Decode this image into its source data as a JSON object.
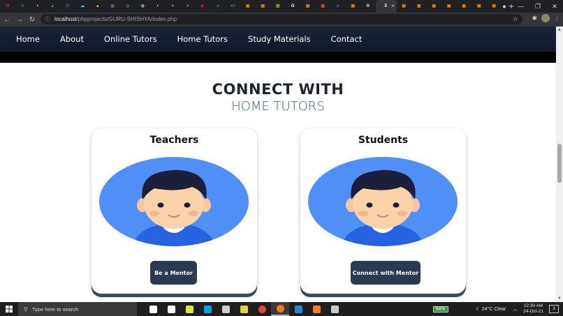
{
  "browser": {
    "tab_favicons": [
      {
        "icon": "gmail-icon",
        "color": "#c5221f",
        "glyph": "M"
      },
      {
        "icon": "docs-icon",
        "color": "#4285f4",
        "glyph": "≡"
      },
      {
        "icon": "app-icon",
        "color": "#e0e0e0",
        "glyph": "•"
      },
      {
        "icon": "drive-icon",
        "color": "#1fa463",
        "glyph": "▲"
      },
      {
        "icon": "d-icon",
        "color": "#1967d2",
        "glyph": "D"
      },
      {
        "icon": "cloud-icon",
        "color": "#4fc3f7",
        "glyph": "☁"
      },
      {
        "icon": "drive-icon",
        "color": "#fbbc04",
        "glyph": "▲"
      },
      {
        "icon": "app-icon",
        "color": "#5f6368",
        "glyph": "▣"
      },
      {
        "icon": "app-icon",
        "color": "#4a6fa5",
        "glyph": "◎"
      },
      {
        "icon": "app-icon",
        "color": "#9aa0a6",
        "glyph": "◉"
      },
      {
        "icon": "app-icon",
        "color": "#e0e0e0",
        "glyph": "•"
      },
      {
        "icon": "app-icon",
        "color": "#e0e0e0",
        "glyph": "•"
      },
      {
        "icon": "app-icon",
        "color": "#e0e0e0",
        "glyph": "•"
      },
      {
        "icon": "youtube-icon",
        "color": "#ff0000",
        "glyph": "▶"
      },
      {
        "icon": "app-icon",
        "color": "#0f9d58",
        "glyph": "●"
      },
      {
        "icon": "code-icon",
        "color": "#34a853",
        "glyph": "<>"
      },
      {
        "icon": "app-icon",
        "color": "#f57c00",
        "glyph": "▣"
      },
      {
        "icon": "app-icon",
        "color": "#f57c00",
        "glyph": "▣"
      },
      {
        "icon": "chart-icon",
        "color": "#c9a227",
        "glyph": "▥"
      },
      {
        "icon": "google-icon",
        "color": "#ffffff",
        "glyph": "G"
      },
      {
        "icon": "app-icon",
        "color": "#f57c00",
        "glyph": "▣"
      },
      {
        "icon": "app-icon",
        "color": "#ea4335",
        "glyph": "▣"
      },
      {
        "icon": "arrow-icon",
        "color": "#4285f4",
        "glyph": "➶"
      },
      {
        "icon": "app-icon",
        "color": "#f57c00",
        "glyph": "▣"
      },
      {
        "icon": "google-icon",
        "color": "#ffffff",
        "glyph": "G"
      }
    ],
    "active_tab_label": "E",
    "trailing_tab_favicons": [
      {
        "icon": "app-icon",
        "color": "#f57c00",
        "glyph": "▣"
      },
      {
        "icon": "app-icon",
        "color": "#f57c00",
        "glyph": "▣"
      },
      {
        "icon": "app-icon",
        "color": "#f57c00",
        "glyph": "▣"
      },
      {
        "icon": "app-icon",
        "color": "#f57c00",
        "glyph": "▣"
      },
      {
        "icon": "app-icon",
        "color": "#f57c00",
        "glyph": "▣"
      },
      {
        "icon": "app-icon",
        "color": "#f57c00",
        "glyph": "▣"
      },
      {
        "icon": "app-icon",
        "color": "#f57c00",
        "glyph": "▣"
      }
    ],
    "url_host": "localhost",
    "url_path": "/phpprojects/GURU-SHISHYA/index.php"
  },
  "nav": {
    "items": [
      "Home",
      "About",
      "Online Tutors",
      "Home Tutors",
      "Study Materials",
      "Contact"
    ]
  },
  "section": {
    "title": "CONNECT WITH",
    "subtitle": "HOME TUTORS"
  },
  "cards": [
    {
      "title": "Teachers",
      "button": "Be a Mentor"
    },
    {
      "title": "Students",
      "button": "Connect with Mentor"
    }
  ],
  "taskbar": {
    "search_placeholder": "Type here to search",
    "battery": "94%",
    "weather": "24°C  Clear",
    "time": "12:30 AM",
    "date": "24-Oct-21",
    "notifications": "3",
    "apps": [
      {
        "icon": "task-view-icon",
        "color": "#ffffff"
      },
      {
        "icon": "multitask-icon",
        "color": "#ffffff"
      },
      {
        "icon": "app-icon",
        "color": "#e0e040"
      },
      {
        "icon": "edge-icon",
        "color": "#0f9de8"
      },
      {
        "icon": "store-icon",
        "color": "#cccccc"
      },
      {
        "icon": "file-explorer-icon",
        "color": "#f2c84b"
      },
      {
        "icon": "chrome-icon",
        "color": "#ea4335"
      },
      {
        "icon": "chrome-icon",
        "color": "#f57c00"
      },
      {
        "icon": "vscode-icon",
        "color": "#2b87d3"
      },
      {
        "icon": "xampp-icon",
        "color": "#fb7a24"
      },
      {
        "icon": "photos-icon",
        "color": "#cccccc"
      }
    ]
  }
}
